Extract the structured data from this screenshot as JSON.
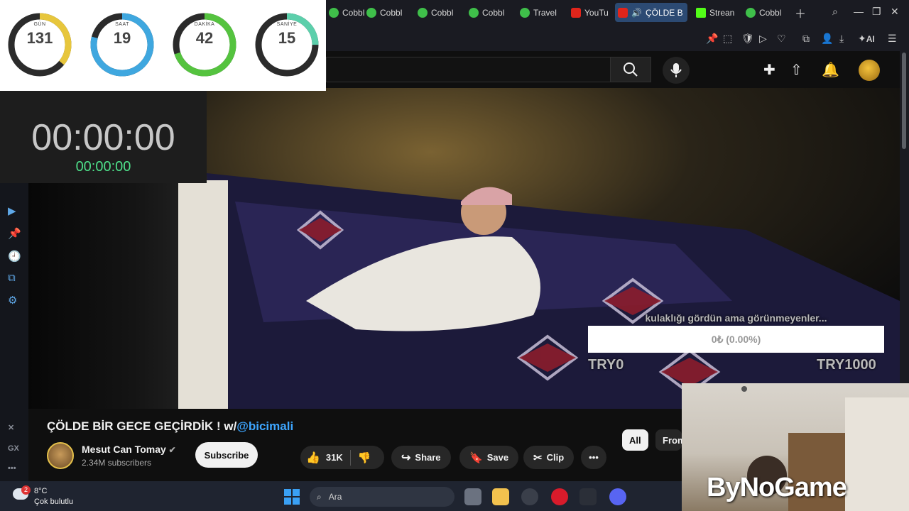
{
  "countdown": {
    "rings": [
      {
        "label": "GÜN",
        "value": "131",
        "fraction": 0.36,
        "color": "#e7c63c"
      },
      {
        "label": "SAAT",
        "value": "19",
        "fraction": 0.79,
        "color": "#3fa7df"
      },
      {
        "label": "DAKİKA",
        "value": "42",
        "fraction": 0.7,
        "color": "#55c33f"
      },
      {
        "label": "SANİYE",
        "value": "15",
        "fraction": 0.25,
        "color": "#5ccfab"
      }
    ]
  },
  "timer": {
    "main": "00:00:00",
    "sub": "00:00:00"
  },
  "tabs": [
    {
      "label": "Cobbl",
      "icon": "cobblemon-icon",
      "active": false
    },
    {
      "label": "Cobbl",
      "icon": "cobblemon-icon",
      "active": false
    },
    {
      "label": "Cobbl",
      "icon": "cobblemon-icon",
      "active": false
    },
    {
      "label": "Cobbl",
      "icon": "cobblemon-icon",
      "active": false
    },
    {
      "label": "Travel",
      "icon": "travel-icon",
      "active": false
    },
    {
      "label": "YouTu",
      "icon": "youtube-icon",
      "active": false
    },
    {
      "label": "ÇÖLDE B",
      "icon": "youtube-icon",
      "active": true
    },
    {
      "label": "Strean",
      "icon": "kick-icon",
      "active": false
    },
    {
      "label": "Cobbl",
      "icon": "cobblemon-icon",
      "active": false
    }
  ],
  "toolbar": {
    "ai_label": "AI"
  },
  "donation": {
    "message": "kulaklığı gördün ama görünmeyenler...",
    "amount": "0₺ (0.00%)",
    "progress": 0.0,
    "min_label": "TRY0",
    "max_label": "TRY1000"
  },
  "video": {
    "title": "ÇÖLDE BİR GECE GEÇİRDİK ! w/",
    "mention": "@bicimali",
    "channel": "Mesut Can Tomay",
    "subscribers": "2.34M subscribers",
    "subscribe_label": "Subscribe",
    "likes": "31K",
    "share_label": "Share",
    "save_label": "Save",
    "clip_label": "Clip"
  },
  "chips": {
    "all": "All",
    "from": "From"
  },
  "sidebar": {
    "gx_label": "GX"
  },
  "webcam": {
    "brand": "ByNoGame"
  },
  "taskbar": {
    "weather_badge": "2",
    "temperature": "8°C",
    "condition": "Çok bulutlu",
    "search_placeholder": "Ara"
  }
}
